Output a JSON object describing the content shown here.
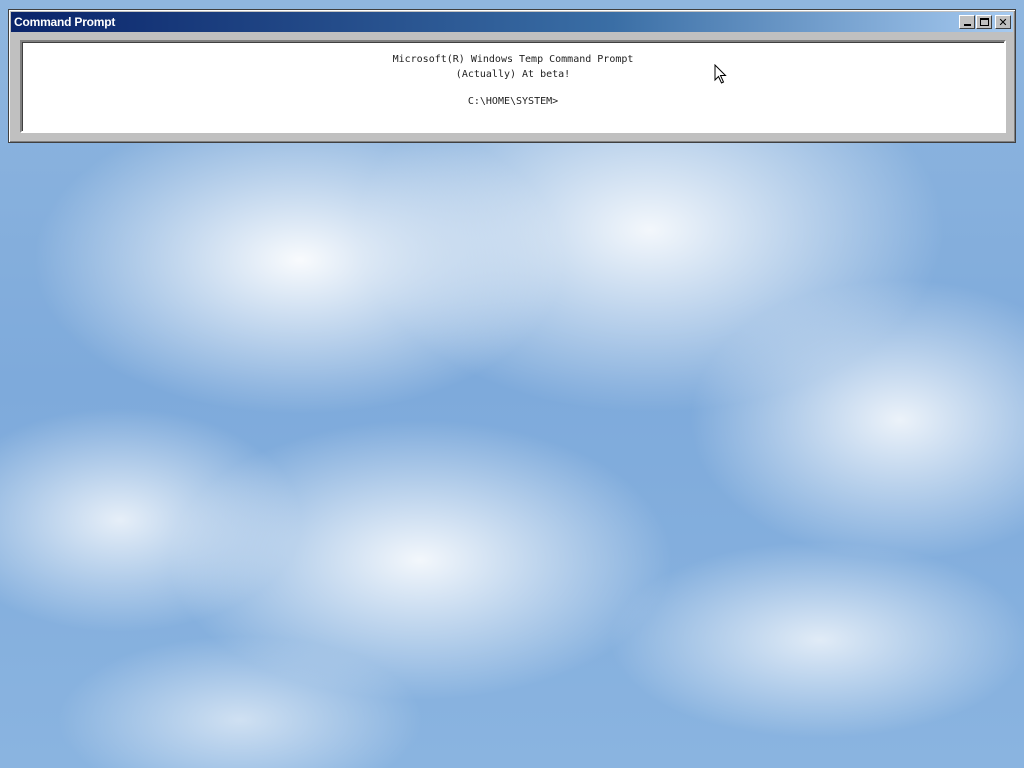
{
  "window": {
    "title": "Command Prompt",
    "controls": {
      "minimize_icon": "minimize-icon",
      "maximize_icon": "maximize-icon",
      "close_icon": "close-icon",
      "close_glyph": "✕"
    }
  },
  "console": {
    "lines": [
      "Microsoft(R) Windows Temp Command Prompt",
      "(Actually) At beta!",
      "C:\\HOME\\SYSTEM>"
    ]
  },
  "colors": {
    "titlebar_start": "#0a246a",
    "titlebar_end": "#a6caf0",
    "window_face": "#c0c0c0",
    "console_bg": "#ffffff",
    "sky": "#7eaadb"
  }
}
